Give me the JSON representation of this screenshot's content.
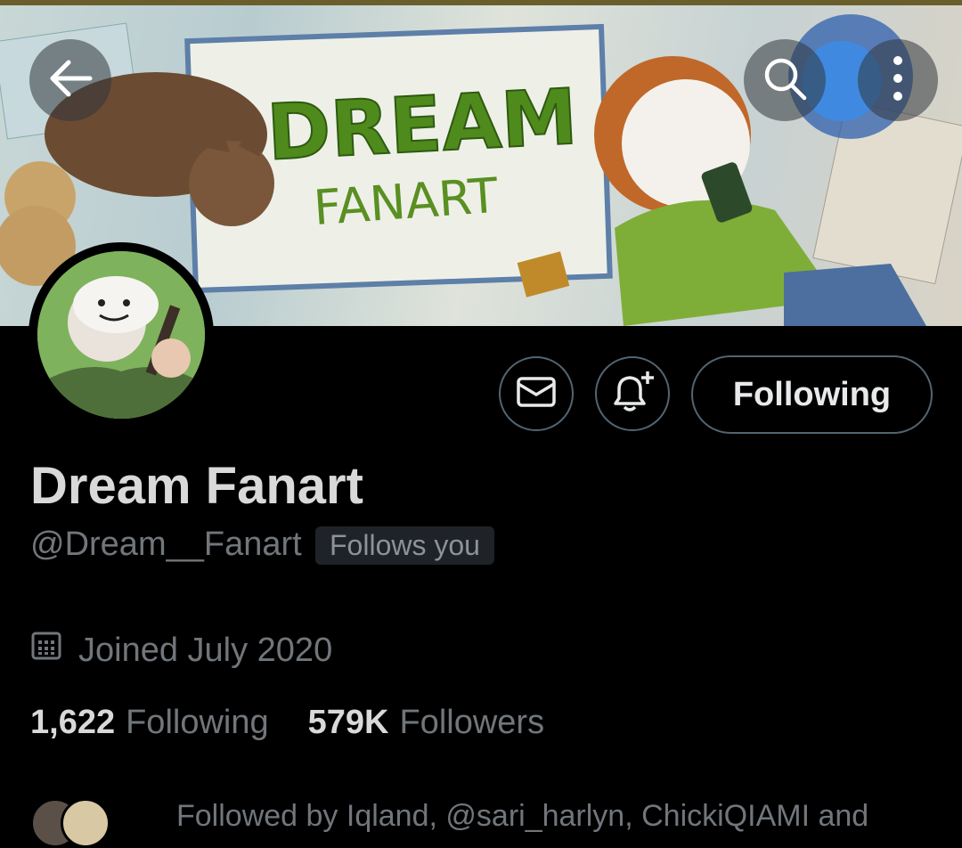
{
  "profile": {
    "display_name": "Dream Fanart",
    "handle": "@Dream__Fanart",
    "follows_you": "Follows you",
    "joined": "Joined July 2020",
    "following_count": "1,622",
    "following_label": "Following",
    "followers_count": "579K",
    "followers_label": "Followers",
    "followed_by": "Followed by Iqland, @sari_harlyn, ChickiQIAMI and"
  },
  "banner": {
    "title_line1": "DREAM",
    "title_line2": "FANART"
  },
  "actions": {
    "following_button": "Following"
  },
  "icons": {
    "back": "arrow-left-icon",
    "search": "search-icon",
    "more": "more-vertical-icon",
    "message": "envelope-icon",
    "notify": "bell-plus-icon",
    "calendar": "calendar-icon"
  },
  "colors": {
    "background": "#000000",
    "primary_text": "#d9d9d9",
    "secondary_text": "#71767b",
    "button_border": "#536471",
    "banner_title": "#4f8a1c"
  }
}
